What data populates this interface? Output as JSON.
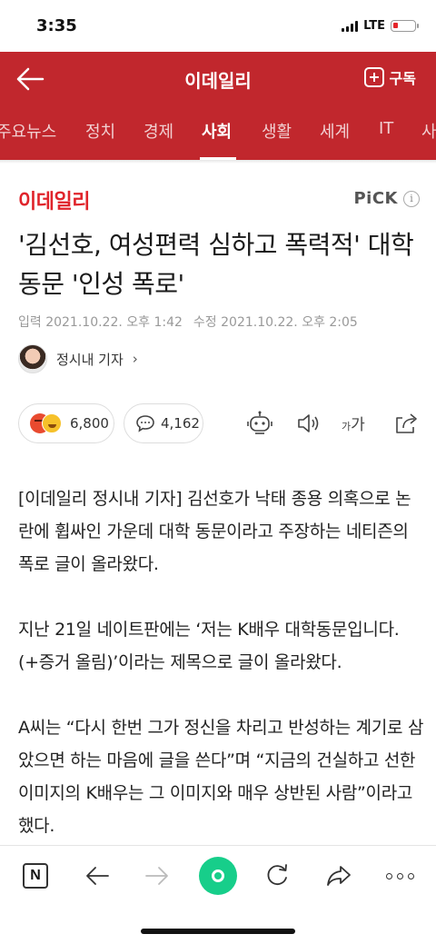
{
  "status": {
    "time": "3:35",
    "network": "LTE"
  },
  "header": {
    "title": "이데일리",
    "subscribe_label": "구독"
  },
  "tabs": [
    {
      "label": "주요뉴스",
      "active": false
    },
    {
      "label": "정치",
      "active": false
    },
    {
      "label": "경제",
      "active": false
    },
    {
      "label": "사회",
      "active": true
    },
    {
      "label": "생활",
      "active": false
    },
    {
      "label": "세계",
      "active": false
    },
    {
      "label": "IT",
      "active": false
    },
    {
      "label": "사",
      "active": false
    }
  ],
  "article": {
    "press_logo": "이데일리",
    "pick_label": "PiCK",
    "pick_info": "i",
    "headline": "'김선호, 여성편력 심하고 폭력적' 대학 동문 '인성 폭로'",
    "published": "입력 2021.10.22. 오후 1:42",
    "modified": "수정 2021.10.22. 오후 2:05",
    "reporter": "정시내 기자",
    "reporter_chevron": "›",
    "reaction_count": "6,800",
    "comment_count": "4,162",
    "font_size_small": "가",
    "font_size_big": "가",
    "paragraphs": [
      "[이데일리 정시내 기자] 김선호가 낙태 종용 의혹으로 논란에 휩싸인 가운데 대학 동문이라고 주장하는 네티즌의 폭로 글이 올라왔다.",
      "지난 21일 네이트판에는 ‘저는 K배우 대학동문입니다.(+증거 올림)’이라는 제목으로 글이 올라왔다.",
      "A씨는 “다시 한번 그가 정신을 차리고 반성하는 계기로 삼았으면 하는 마음에 글을 쓴다”며 “지금의 건실하고 선한 이미지의 K배우는 그 이미지와 매우 상반된 사람”이라고 했다."
    ]
  },
  "bottom_bar": {
    "n_logo": "N"
  },
  "colors": {
    "brand_red": "#c1272d",
    "logo_red": "#e0242b",
    "green": "#17ce8a"
  }
}
